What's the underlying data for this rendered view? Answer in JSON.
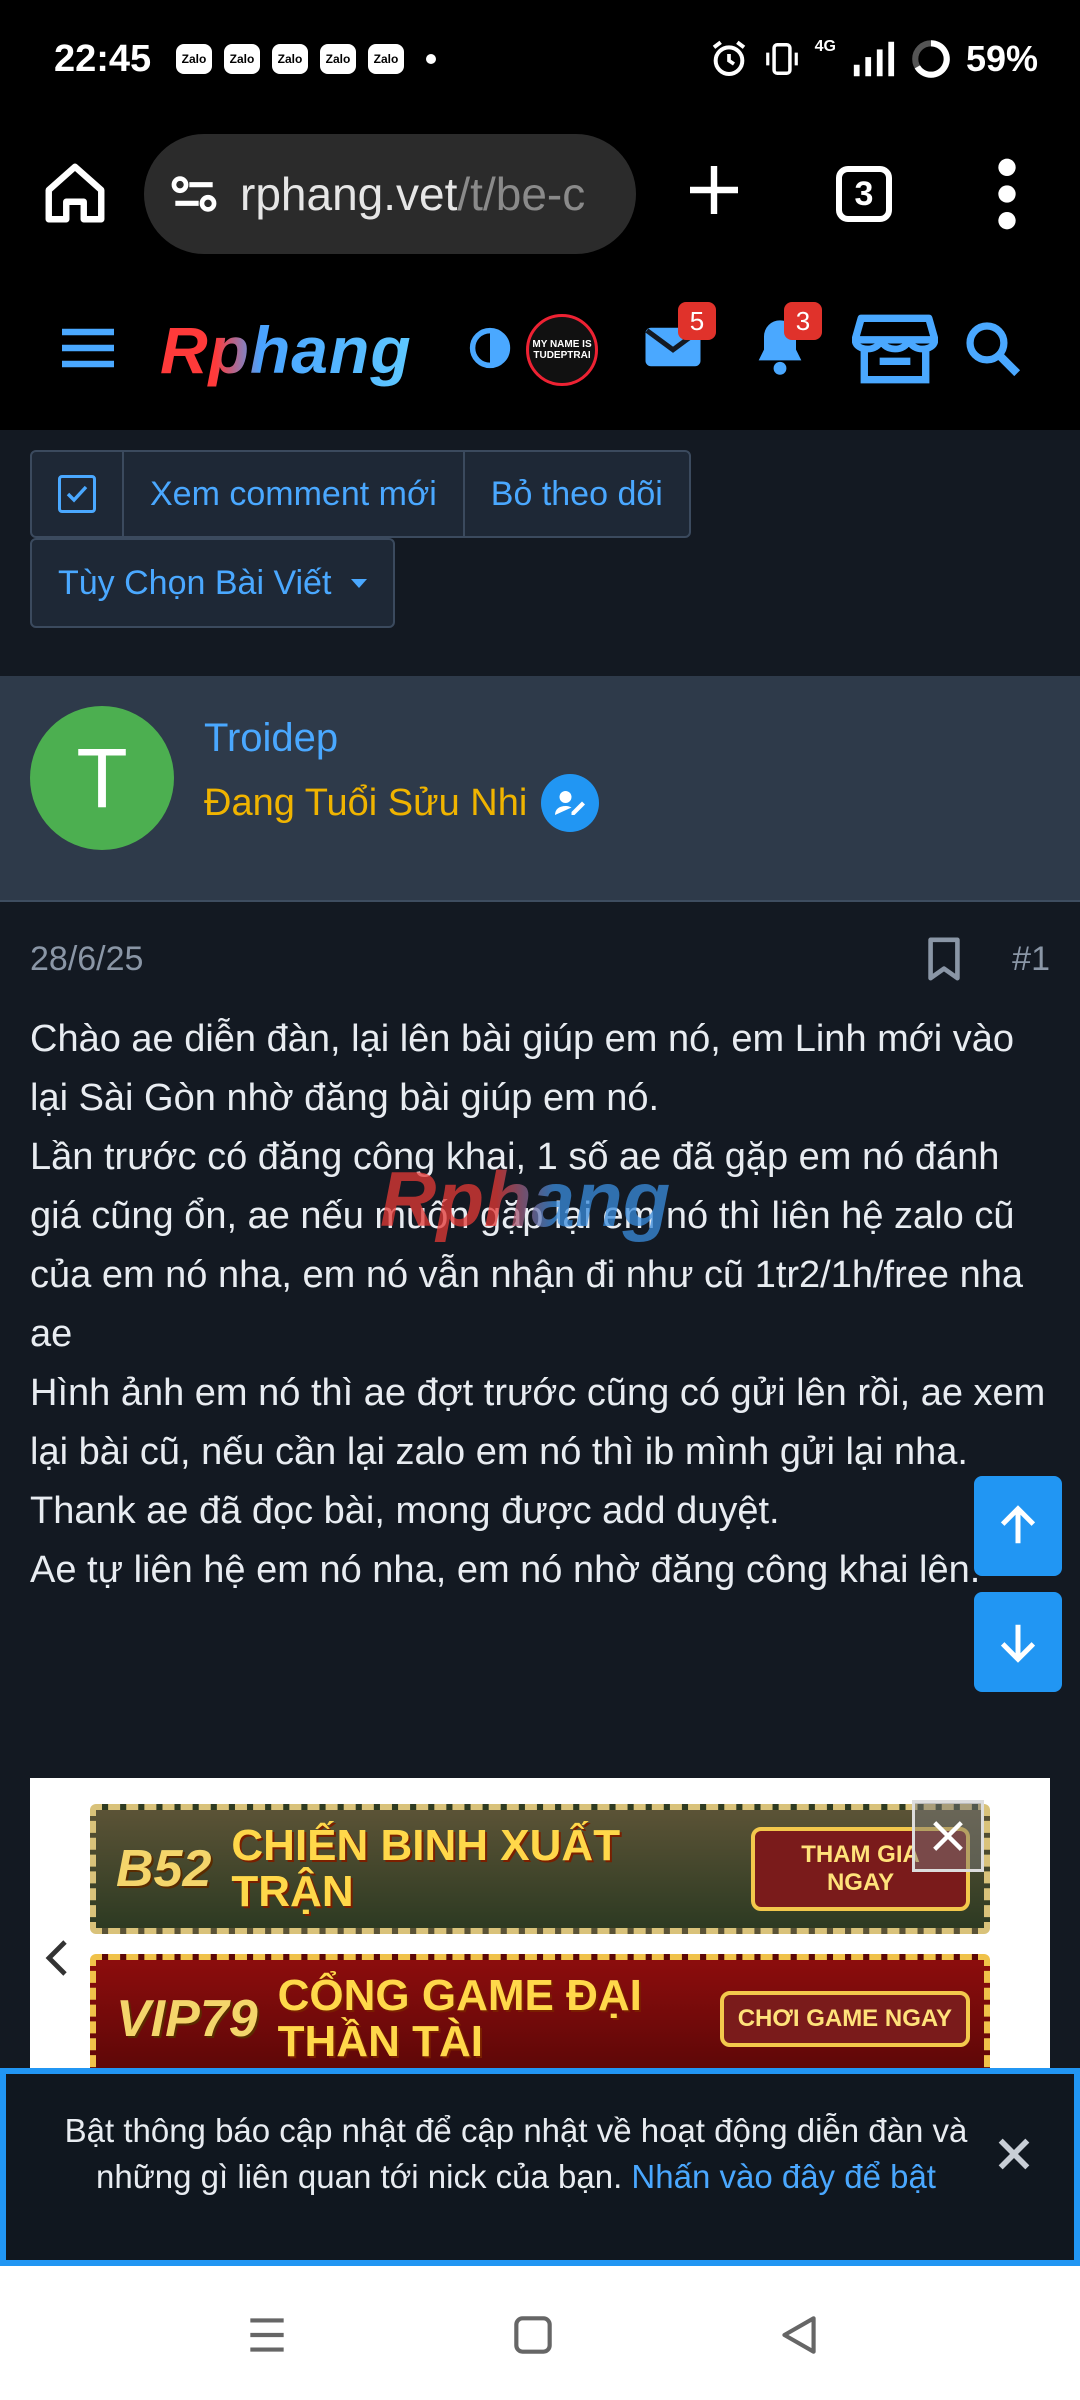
{
  "status_bar": {
    "time": "22:45",
    "notification_apps": [
      "Zalo",
      "Zalo",
      "Zalo",
      "Zalo",
      "Zalo"
    ],
    "network": "4G",
    "battery": "59%"
  },
  "browser": {
    "url_host": "rphang.vet",
    "url_path": "/t/be-c",
    "tab_count": "3"
  },
  "site_header": {
    "logo": "Rphang",
    "avatar_badge_text": "MY NAME IS TUDEPTRAI",
    "messages_badge": "5",
    "alerts_badge": "3"
  },
  "thread_actions": {
    "view_new_comments": "Xem comment mới",
    "unfollow": "Bỏ theo dõi",
    "post_options": "Tùy Chọn Bài Viết"
  },
  "post": {
    "author": {
      "initial": "T",
      "name": "Troidep",
      "title": "Đang Tuổi Sửu Nhi"
    },
    "date": "28/6/25",
    "number": "#1",
    "watermark": "Rphang",
    "lines": [
      "Chào ae diễn đàn, lại lên bài giúp em nó, em Linh mới vào lại Sài Gòn nhờ đăng bài giúp em nó.",
      "Lần trước có đăng công khai, 1 số ae đã gặp em nó đánh giá cũng ổn, ae nếu muốn gặp lại em nó thì liên hệ zalo cũ của em nó nha, em nó vẫn nhận đi như cũ 1tr2/1h/free nha ae",
      "Hình ảnh em nó thì ae đợt trước cũng có gửi lên rồi, ae xem lại bài cũ, nếu cần lại zalo em nó thì ib mình gửi lại nha.",
      "Thank ae đã đọc bài, mong được add duyệt.",
      "Ae tự liên hệ em nó nha, em nó nhờ đăng công khai lên."
    ]
  },
  "ads": [
    {
      "logo": "B52",
      "text": "CHIẾN BINH XUẤT TRẬN",
      "cta": "THAM GIA NGAY"
    },
    {
      "logo": "VIP79",
      "text": "CỔNG GAME ĐẠI THẦN TÀI",
      "cta": "CHƠI GAME NGAY"
    }
  ],
  "notice": {
    "text": "Bật thông báo cập nhật để cập nhật về hoạt động diễn đàn và những gì liên quan tới nick của bạn. ",
    "link": "Nhấn vào đây để bật"
  },
  "colors": {
    "accent": "#4aa8ff",
    "content_bg": "#131922",
    "user_block_bg": "#2e3a4a",
    "user_title": "#f0b400",
    "badge": "#e0322b",
    "scroll_buttons": "#2196f3"
  }
}
